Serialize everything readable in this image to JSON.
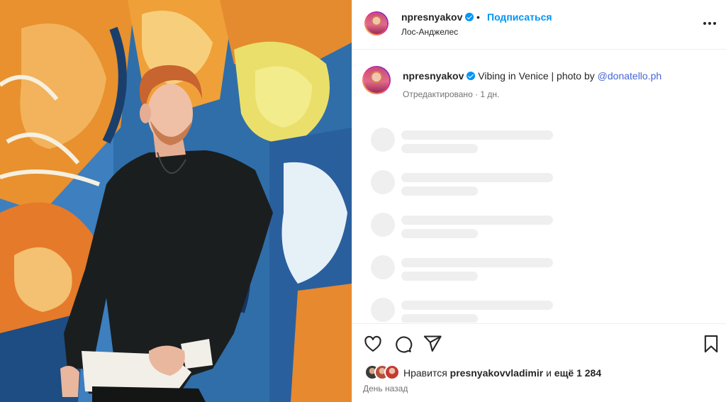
{
  "header": {
    "username": "npresnyakov",
    "separator": "•",
    "follow_label": "Подписаться",
    "location": "Лос-Анджелес",
    "more_icon": "more-horizontal-icon"
  },
  "caption": {
    "username": "npresnyakov",
    "text": "Vibing in Venice | photo by ",
    "mention": "@donatello.ph",
    "edited": "Отредактировано · 1 дн."
  },
  "actions": {
    "like_icon": "heart-icon",
    "comment_icon": "comment-icon",
    "share_icon": "send-icon",
    "save_icon": "bookmark-icon"
  },
  "likes": {
    "prefix": "Нравится ",
    "user": "presnyakovvladimir",
    "middle": " и ",
    "count": "ещё 1 284"
  },
  "timestamp": "День назад",
  "colors": {
    "accent": "#0095f6",
    "mention": "#4666d5",
    "text": "#262626",
    "secondary": "#737373",
    "skeleton": "#efefef"
  }
}
